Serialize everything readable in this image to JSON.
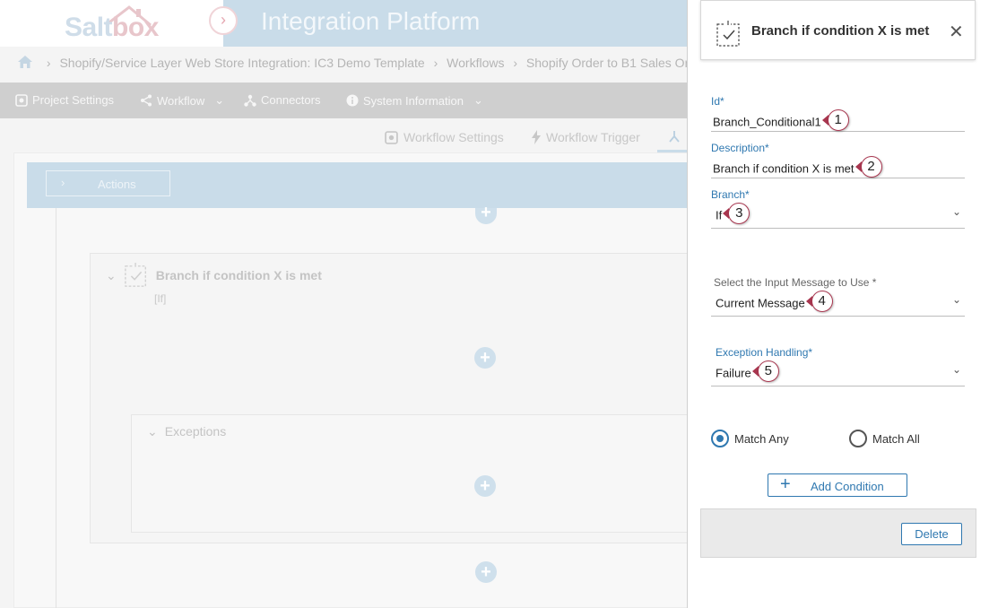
{
  "app": {
    "logo_main": "Salt",
    "logo_accent": "box",
    "title": "Integration Platform"
  },
  "breadcrumb": {
    "items": [
      "Shopify/Service Layer Web Store Integration: IC3 Demo Template",
      "Workflows",
      "Shopify Order to B1 Sales Or"
    ]
  },
  "navbar": {
    "project_settings": "Project Settings",
    "workflow": "Workflow",
    "connectors": "Connectors",
    "system_information": "System Information"
  },
  "subtabs": {
    "workflow_settings": "Workflow Settings",
    "workflow_trigger": "Workflow Trigger"
  },
  "canvas": {
    "actions_label": "Actions",
    "branch_title": "Branch if condition X is met",
    "branch_subtitle": "[If]",
    "exceptions_label": "Exceptions"
  },
  "panel": {
    "title": "Branch if condition X is met",
    "fields": {
      "id": {
        "label": "Id*",
        "value": "Branch_Conditional1",
        "callout": "1"
      },
      "description": {
        "label": "Description*",
        "value": "Branch if condition X is met",
        "callout": "2"
      },
      "branch": {
        "label": "Branch*",
        "value": "If",
        "callout": "3"
      },
      "input_message": {
        "label": "Select the Input Message to Use *",
        "value": "Current Message",
        "callout": "4"
      },
      "exception_handling": {
        "label": "Exception Handling*",
        "value": "Failure",
        "callout": "5"
      }
    },
    "match_any": "Match Any",
    "match_all": "Match All",
    "match_selected": "Match Any",
    "add_condition": "Add Condition",
    "delete": "Delete"
  },
  "colors": {
    "accent": "#2f78b0",
    "callout": "#a8364f",
    "header_band": "#c9dce9"
  }
}
